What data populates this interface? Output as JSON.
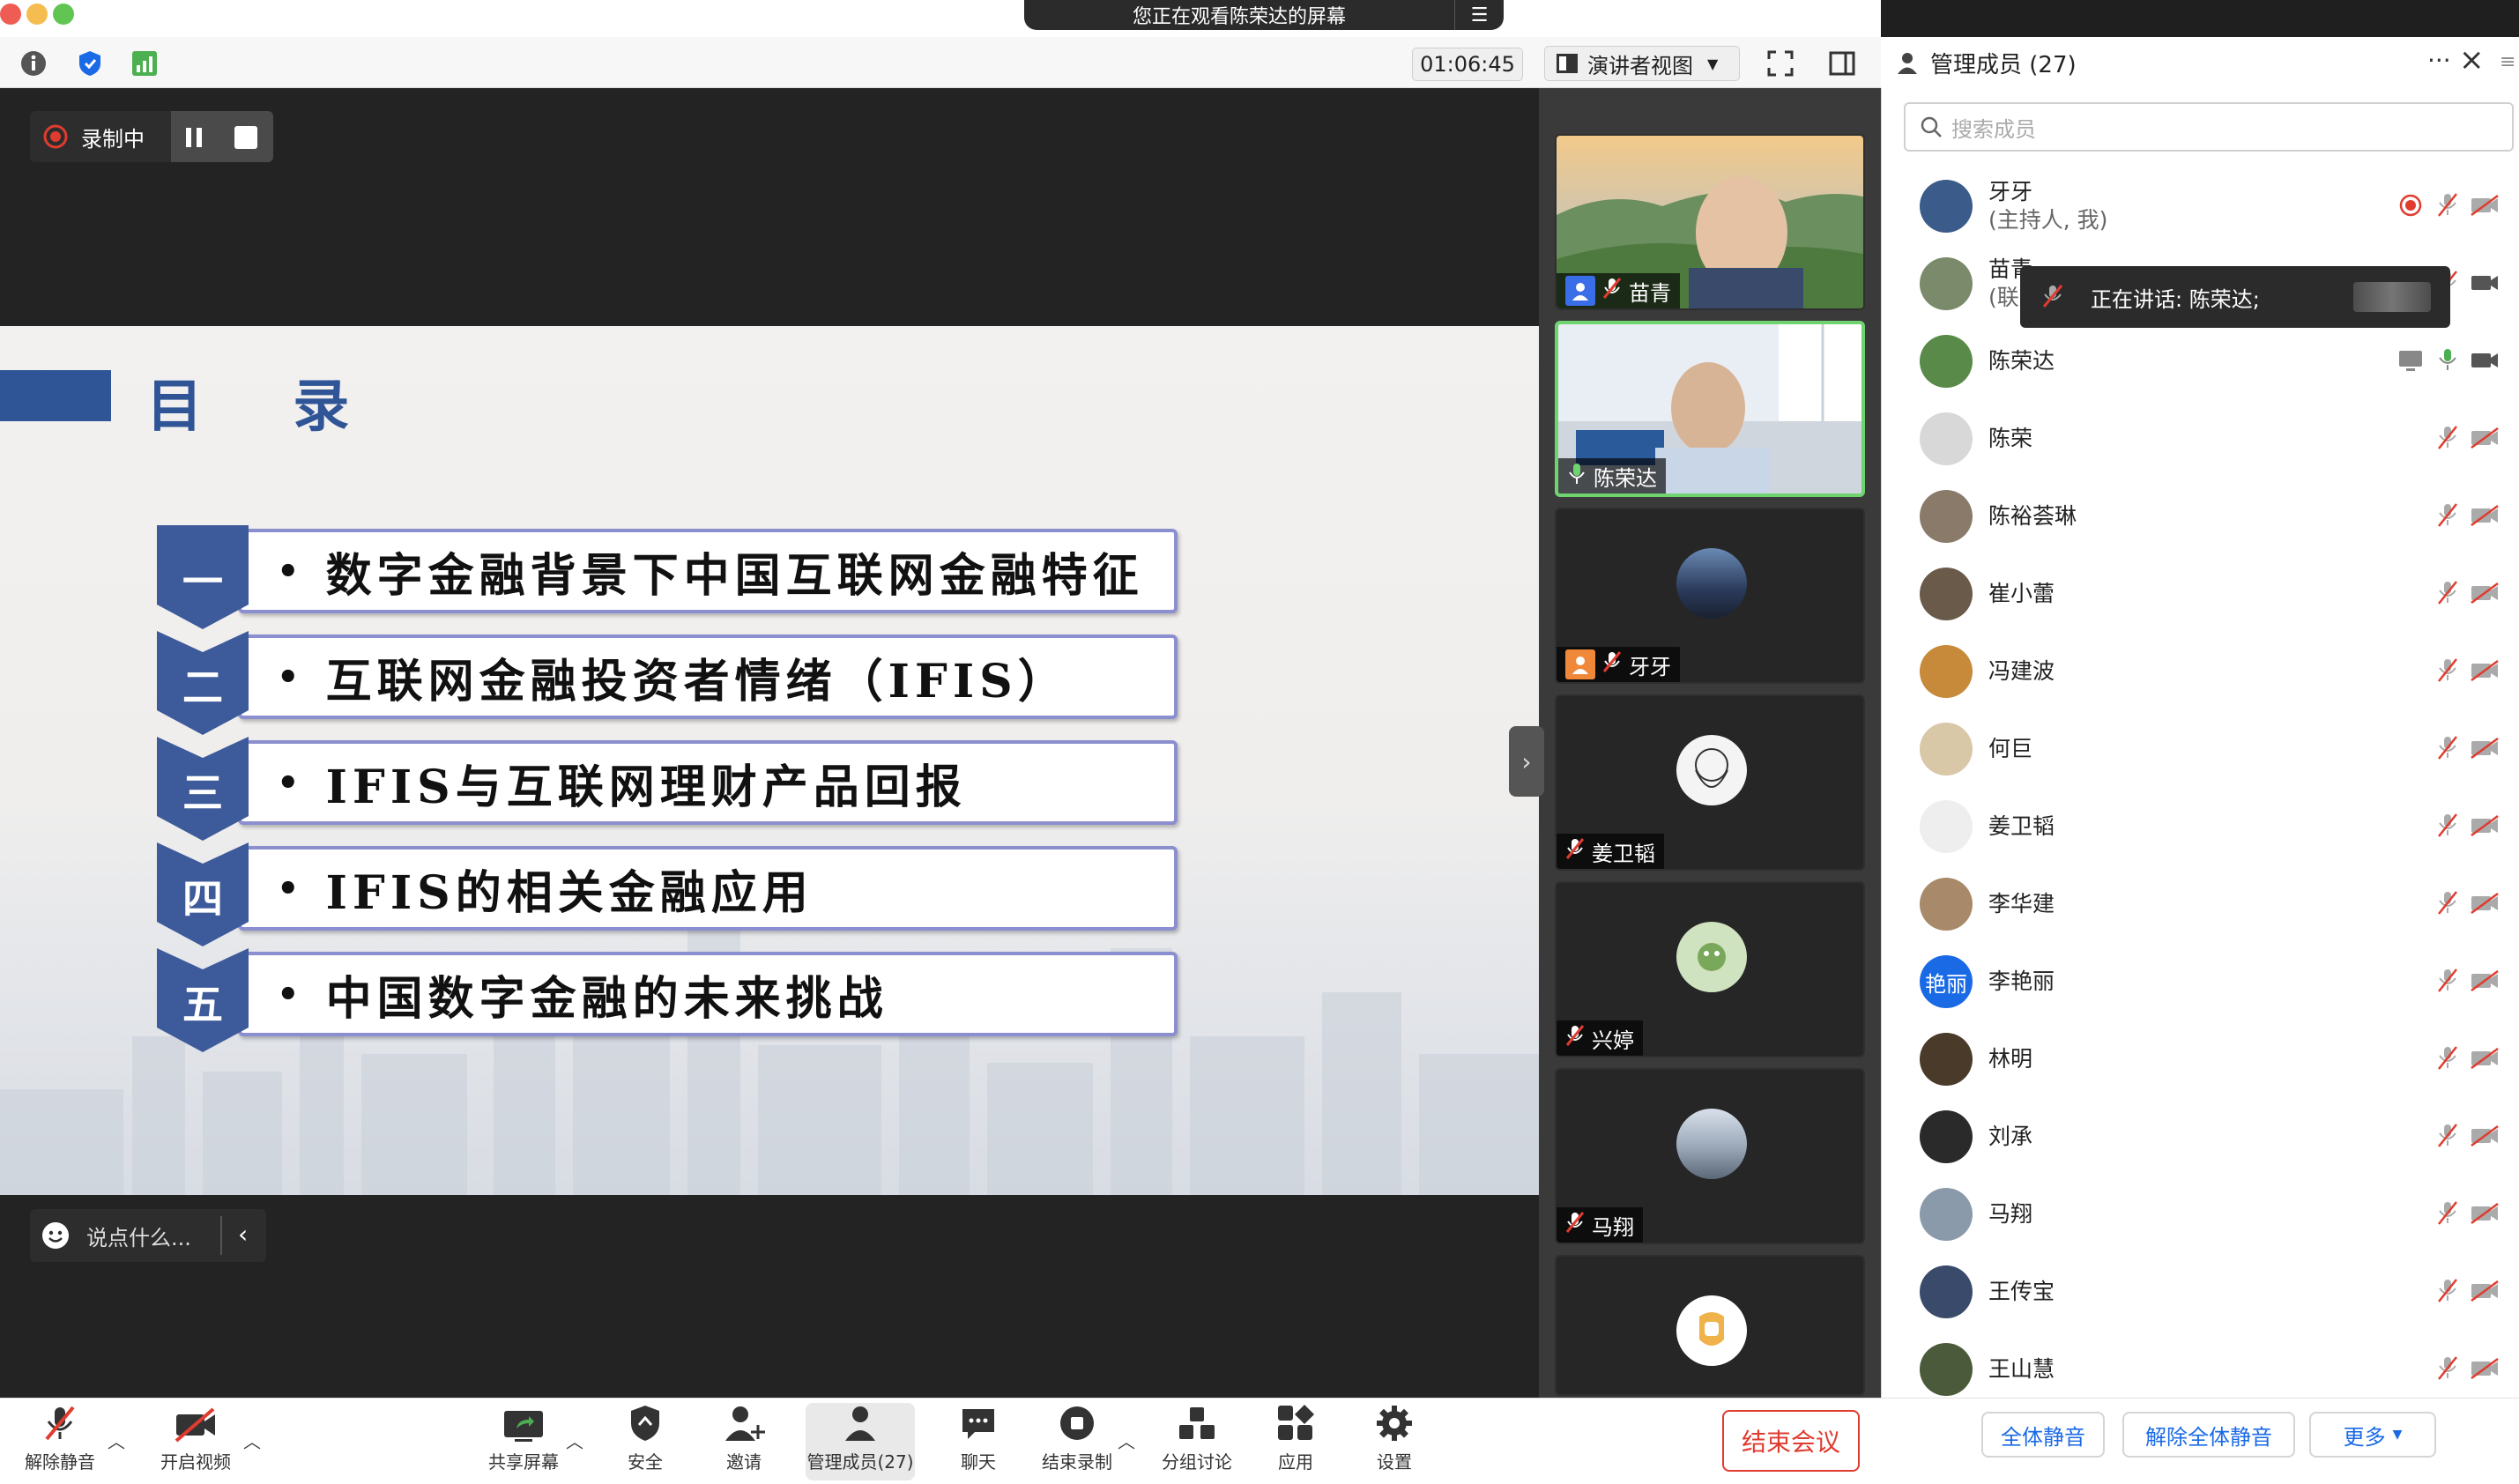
{
  "window": {
    "share_banner": "您正在观看陈荣达的屏幕",
    "timer": "01:06:45",
    "view_mode": "演讲者视图"
  },
  "recording": {
    "status_label": "录制中"
  },
  "chat_input": {
    "placeholder": "说点什么..."
  },
  "slide": {
    "title": "目 录",
    "items": [
      {
        "number": "一",
        "text": "数字金融背景下中国互联网金融特征"
      },
      {
        "number": "二",
        "text": "互联网金融投资者情绪（IFIS）"
      },
      {
        "number": "三",
        "text": "IFIS与互联网理财产品回报"
      },
      {
        "number": "四",
        "text": "IFIS的相关金融应用"
      },
      {
        "number": "五",
        "text": "中国数字金融的未来挑战"
      }
    ]
  },
  "video_tiles": [
    {
      "name": "苗青",
      "type": "video",
      "muted": true,
      "host_badge": true,
      "host_color": "#3a6ee8"
    },
    {
      "name": "陈荣达",
      "type": "video",
      "muted": false,
      "speaking": true
    },
    {
      "name": "牙牙",
      "type": "avatar",
      "muted": true,
      "host_badge": true,
      "host_color": "#f0883a"
    },
    {
      "name": "姜卫韬",
      "type": "avatar",
      "muted": true
    },
    {
      "name": "兴婷",
      "type": "avatar",
      "muted": true
    },
    {
      "name": "马翔",
      "type": "avatar",
      "muted": true
    },
    {
      "name": "",
      "type": "avatar",
      "muted": true
    }
  ],
  "panel": {
    "title": "管理成员 (27)",
    "search_placeholder": "搜索成员",
    "tooltip": "正在讲话: 陈荣达;",
    "participants": [
      {
        "name": "牙牙",
        "sub": "(主持人, 我)",
        "recording": true,
        "mic": "muted",
        "video": "off",
        "avatar_color": "#3b5b8a"
      },
      {
        "name": "苗青",
        "sub": "(联",
        "mic": "muted",
        "video": "on",
        "avatar_color": "#7a8a6a"
      },
      {
        "name": "陈荣达",
        "sub": "",
        "sharing": true,
        "mic": "active",
        "video": "on",
        "avatar_color": "#5a8a4a"
      },
      {
        "name": "陈荣",
        "sub": "",
        "mic": "muted",
        "video": "off",
        "avatar_color": "#d8d8d8"
      },
      {
        "name": "陈裕荟琳",
        "sub": "",
        "mic": "muted",
        "video": "off",
        "avatar_color": "#8a7a6a"
      },
      {
        "name": "崔小蕾",
        "sub": "",
        "mic": "muted",
        "video": "off",
        "avatar_color": "#6a5a4a"
      },
      {
        "name": "冯建波",
        "sub": "",
        "mic": "muted",
        "video": "off",
        "avatar_color": "#c78a3a"
      },
      {
        "name": "何巨",
        "sub": "",
        "mic": "muted",
        "video": "off",
        "avatar_color": "#d8c8a8"
      },
      {
        "name": "姜卫韬",
        "sub": "",
        "mic": "muted",
        "video": "off",
        "avatar_color": "#eeeeee"
      },
      {
        "name": "李华建",
        "sub": "",
        "mic": "muted",
        "video": "off",
        "avatar_color": "#a88a6a"
      },
      {
        "name": "李艳丽",
        "sub": "",
        "avatar_text": "艳丽",
        "mic": "muted",
        "video": "off",
        "avatar_color": "#1a6ae6"
      },
      {
        "name": "林明",
        "sub": "",
        "mic": "muted",
        "video": "off",
        "avatar_color": "#4a3a2a"
      },
      {
        "name": "刘承",
        "sub": "",
        "mic": "muted",
        "video": "off",
        "avatar_color": "#2a2a2a"
      },
      {
        "name": "马翔",
        "sub": "",
        "mic": "muted",
        "video": "off",
        "avatar_color": "#8a9aaa"
      },
      {
        "name": "王传宝",
        "sub": "",
        "mic": "muted",
        "video": "off",
        "avatar_color": "#3a4a6a"
      },
      {
        "name": "王山慧",
        "sub": "",
        "mic": "muted",
        "video": "off",
        "avatar_color": "#4a5a3a"
      }
    ],
    "footer": {
      "mute_all": "全体静音",
      "unmute_all": "解除全体静音",
      "more": "更多"
    }
  },
  "bottom_toolbar": {
    "unmute": "解除静音",
    "start_video": "开启视频",
    "share_screen": "共享屏幕",
    "security": "安全",
    "invite": "邀请",
    "participants": "管理成员(27)",
    "chat": "聊天",
    "end_recording": "结束录制",
    "breakout": "分组讨论",
    "apps": "应用",
    "settings": "设置",
    "end_meeting": "结束会议"
  },
  "colors": {
    "accent_blue": "#1a6ae6",
    "slide_blue": "#2f5597",
    "speaking_green": "#6fd36f",
    "danger_red": "#e03b2f"
  }
}
